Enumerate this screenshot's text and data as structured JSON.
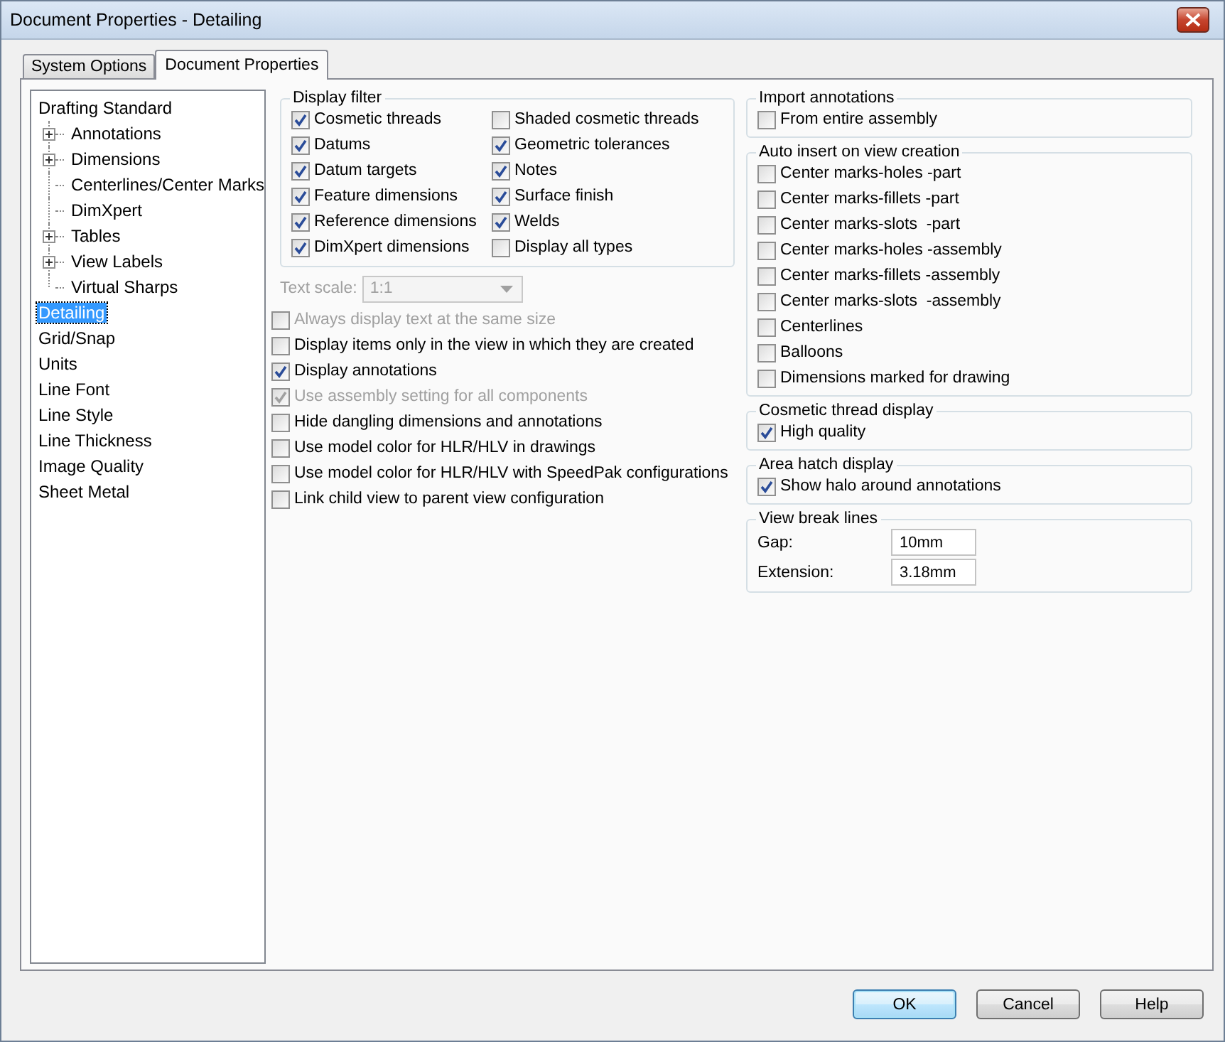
{
  "window": {
    "title": "Document Properties - Detailing"
  },
  "tabs": [
    {
      "label": "System Options",
      "selected": false
    },
    {
      "label": "Document Properties",
      "selected": true
    }
  ],
  "tree": [
    {
      "label": "Drafting Standard",
      "selected": false,
      "children": [
        {
          "label": "Annotations",
          "expandable": true,
          "selected": false
        },
        {
          "label": "Dimensions",
          "expandable": true,
          "selected": false
        },
        {
          "label": "Centerlines/Center Marks",
          "expandable": false,
          "selected": false
        },
        {
          "label": "DimXpert",
          "expandable": false,
          "selected": false
        },
        {
          "label": "Tables",
          "expandable": true,
          "selected": false
        },
        {
          "label": "View Labels",
          "expandable": true,
          "selected": false
        },
        {
          "label": "Virtual Sharps",
          "expandable": false,
          "selected": false
        }
      ]
    },
    {
      "label": "Detailing",
      "selected": true
    },
    {
      "label": "Grid/Snap",
      "selected": false
    },
    {
      "label": "Units",
      "selected": false
    },
    {
      "label": "Line Font",
      "selected": false
    },
    {
      "label": "Line Style",
      "selected": false
    },
    {
      "label": "Line Thickness",
      "selected": false
    },
    {
      "label": "Image Quality",
      "selected": false
    },
    {
      "label": "Sheet Metal",
      "selected": false
    }
  ],
  "display_filter": {
    "title": "Display filter",
    "columns": [
      [
        {
          "label": "Cosmetic threads",
          "checked": true
        },
        {
          "label": "Datums",
          "checked": true
        },
        {
          "label": "Datum targets",
          "checked": true
        },
        {
          "label": "Feature dimensions",
          "checked": true
        },
        {
          "label": "Reference dimensions",
          "checked": true
        },
        {
          "label": "DimXpert dimensions",
          "checked": true
        }
      ],
      [
        {
          "label": "Shaded cosmetic threads",
          "checked": false
        },
        {
          "label": "Geometric tolerances",
          "checked": true
        },
        {
          "label": "Notes",
          "checked": true
        },
        {
          "label": "Surface finish",
          "checked": true
        },
        {
          "label": "Welds",
          "checked": true
        },
        {
          "label": "Display all types",
          "checked": false
        }
      ]
    ]
  },
  "text_scale": {
    "label": "Text scale:",
    "value": "1:1",
    "disabled": true
  },
  "options": [
    {
      "label": "Always display text at the same size",
      "checked": false,
      "disabled": true
    },
    {
      "label": "Display items only in the view in which they are created",
      "checked": false,
      "disabled": false
    },
    {
      "label": "Display annotations",
      "checked": true,
      "disabled": false
    },
    {
      "label": "Use assembly setting for all components",
      "checked": true,
      "disabled": true
    },
    {
      "label": "Hide dangling dimensions and annotations",
      "checked": false,
      "disabled": false
    },
    {
      "label": "Use model color for HLR/HLV in drawings",
      "checked": false,
      "disabled": false
    },
    {
      "label": "Use model color for HLR/HLV with SpeedPak configurations",
      "checked": false,
      "disabled": false
    },
    {
      "label": "Link child view to parent view configuration",
      "checked": false,
      "disabled": false
    }
  ],
  "groups": [
    {
      "title": "Import annotations",
      "items": [
        {
          "label": "From entire assembly",
          "checked": false
        }
      ]
    },
    {
      "title": "Auto insert on view creation",
      "items": [
        {
          "label": "Center marks-holes -part",
          "checked": false
        },
        {
          "label": "Center marks-fillets -part",
          "checked": false
        },
        {
          "label": "Center marks-slots  -part",
          "checked": false
        },
        {
          "label": "Center marks-holes -assembly",
          "checked": false
        },
        {
          "label": "Center marks-fillets -assembly",
          "checked": false
        },
        {
          "label": "Center marks-slots  -assembly",
          "checked": false
        },
        {
          "label": "Centerlines",
          "checked": false
        },
        {
          "label": "Balloons",
          "checked": false
        },
        {
          "label": "Dimensions marked for drawing",
          "checked": false
        }
      ]
    },
    {
      "title": "Cosmetic thread display",
      "items": [
        {
          "label": "High quality",
          "checked": true
        }
      ]
    },
    {
      "title": "Area hatch display",
      "items": [
        {
          "label": "Show halo around annotations",
          "checked": true
        }
      ]
    }
  ],
  "view_break_lines": {
    "title": "View break lines",
    "fields": [
      {
        "label": "Gap:",
        "value": "10mm"
      },
      {
        "label": "Extension:",
        "value": "3.18mm"
      }
    ]
  },
  "buttons": [
    {
      "label": "OK",
      "default": true
    },
    {
      "label": "Cancel",
      "default": false
    },
    {
      "label": "Help",
      "default": false
    }
  ]
}
